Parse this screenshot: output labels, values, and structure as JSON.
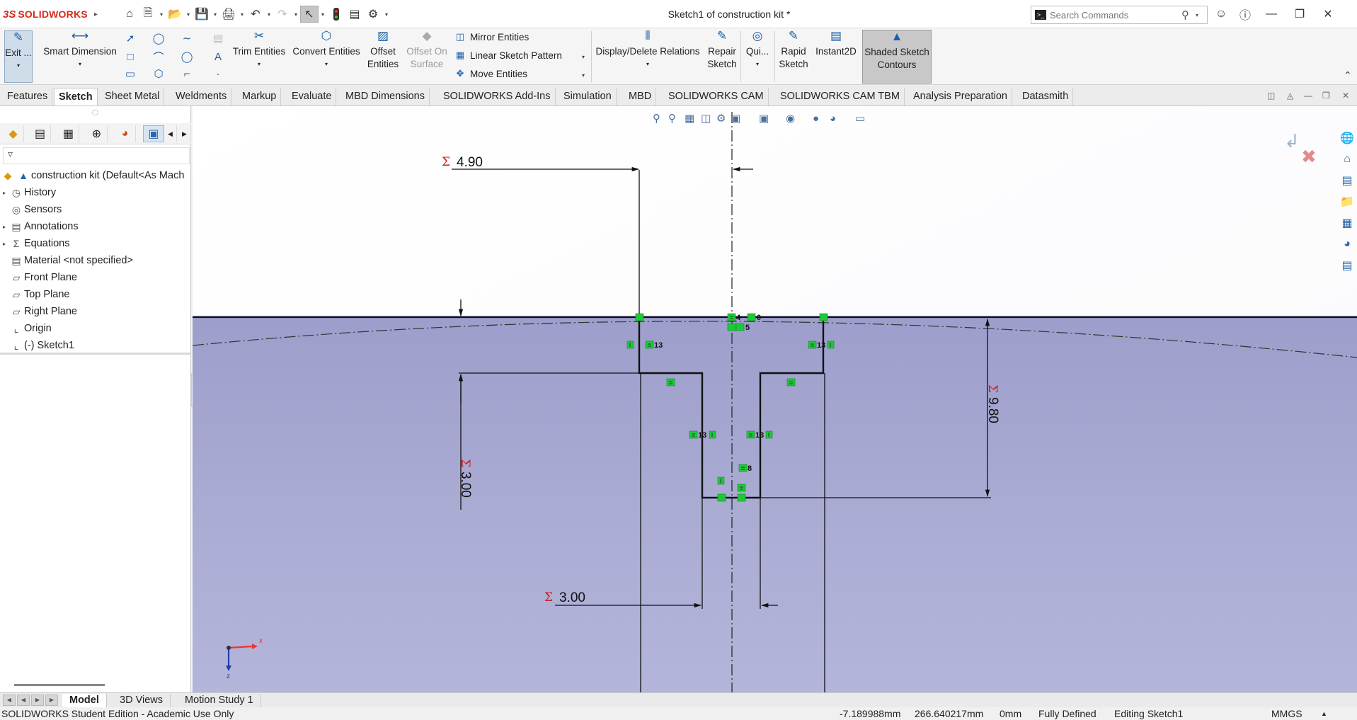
{
  "titlebar": {
    "logo_ds": "3S",
    "logo_text": "SOLIDWORKS",
    "document_title": "Sketch1 of construction kit *",
    "search_placeholder": "Search Commands",
    "icons": [
      "home-icon",
      "new-doc-icon",
      "open-icon",
      "save-icon",
      "print-icon",
      "undo-icon",
      "redo-icon",
      "select-icon",
      "traffic-light-icon",
      "file-properties-icon",
      "options-gear-icon"
    ]
  },
  "ribbon": {
    "exit_sketch": "Exit ...",
    "smart_dimension": "Smart Dimension",
    "trim_entities": "Trim Entities",
    "convert_entities": "Convert Entities",
    "offset_entities_1": "Offset",
    "offset_entities_2": "Entities",
    "offset_on_surface_1": "Offset On",
    "offset_on_surface_2": "Surface",
    "mirror_entities": "Mirror Entities",
    "linear_sketch_pattern": "Linear Sketch Pattern",
    "move_entities": "Move Entities",
    "display_delete_relations": "Display/Delete Relations",
    "repair_sketch_1": "Repair",
    "repair_sketch_2": "Sketch",
    "quick_snaps": "Qui...",
    "rapid_sketch_1": "Rapid",
    "rapid_sketch_2": "Sketch",
    "instant2d": "Instant2D",
    "shaded_contours_1": "Shaded Sketch",
    "shaded_contours_2": "Contours"
  },
  "tabs": [
    "Features",
    "Sketch",
    "Sheet Metal",
    "Weldments",
    "Markup",
    "Evaluate",
    "MBD Dimensions",
    "SOLIDWORKS Add-Ins",
    "Simulation",
    "MBD",
    "SOLIDWORKS CAM",
    "SOLIDWORKS CAM TBM",
    "Analysis Preparation",
    "Datasmith"
  ],
  "active_tab": "Sketch",
  "tree": {
    "root": "construction kit  (Default<As Mach",
    "items": [
      {
        "label": "History",
        "icon": "history-icon",
        "expandable": true
      },
      {
        "label": "Sensors",
        "icon": "sensors-icon",
        "expandable": false
      },
      {
        "label": "Annotations",
        "icon": "annotations-icon",
        "expandable": true
      },
      {
        "label": "Equations",
        "icon": "equations-icon",
        "expandable": true
      },
      {
        "label": "Material <not specified>",
        "icon": "material-icon",
        "expandable": false
      },
      {
        "label": "Front Plane",
        "icon": "plane-icon",
        "expandable": false
      },
      {
        "label": "Top Plane",
        "icon": "plane-icon",
        "expandable": false
      },
      {
        "label": "Right Plane",
        "icon": "plane-icon",
        "expandable": false
      },
      {
        "label": "Origin",
        "icon": "origin-icon",
        "expandable": false
      },
      {
        "label": "(-) Sketch1",
        "icon": "sketch-icon",
        "expandable": false
      }
    ]
  },
  "sketch": {
    "dim_top_width": "4.90",
    "dim_left_height": "3.00",
    "dim_right_height": "9.80",
    "dim_bottom_width": "3.00",
    "sigma": "Σ",
    "relation_labels": [
      "4",
      "0",
      "5",
      "13",
      "13",
      "13",
      "13",
      "8"
    ],
    "axis_x_label": "x",
    "axis_z_label": "z"
  },
  "bottom_tabs": [
    "Model",
    "3D Views",
    "Motion Study 1"
  ],
  "active_bottom_tab": "Model",
  "status": {
    "edition": "SOLIDWORKS Student Edition - Academic Use Only",
    "x_coord": "-7.189988mm",
    "y_coord": "266.640217mm",
    "z_coord": "0mm",
    "definition": "Fully Defined",
    "editing": "Editing Sketch1",
    "units": "MMGS"
  },
  "colors": {
    "accent_blue": "#1a5fa8",
    "sketch_background_top": "#ffffff",
    "sketch_background_lower": "#a9aad2",
    "relation_green": "#1fc83a",
    "dimension_sigma_red": "#d21b1b"
  }
}
